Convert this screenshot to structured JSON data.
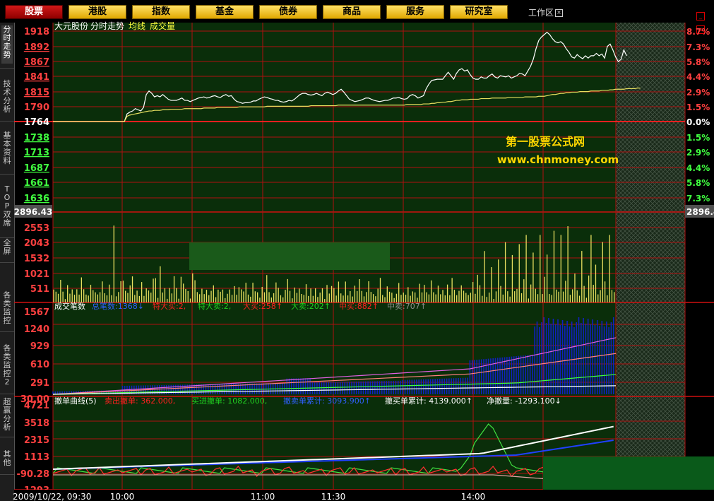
{
  "tabs": [
    {
      "label": "股票",
      "active": true
    },
    {
      "label": "港股"
    },
    {
      "label": "指数"
    },
    {
      "label": "基金"
    },
    {
      "label": "债券"
    },
    {
      "label": "商品"
    },
    {
      "label": "服务"
    },
    {
      "label": "研究室"
    }
  ],
  "workarea": {
    "label": "工作区",
    "close": "×"
  },
  "window_controls": [
    "_",
    "▫"
  ],
  "sidebar": [
    {
      "label": "分时走势",
      "active": true
    },
    {
      "label": "技术分析"
    },
    {
      "label": "基本资料"
    },
    {
      "label": "TOP双席"
    },
    {
      "label": "全屏"
    },
    {
      "label": "各类监控"
    },
    {
      "label": "各类监控2"
    },
    {
      "label": "超赢分析"
    },
    {
      "label": "其他"
    }
  ],
  "header": {
    "name": "大元股份",
    "view": "分时走势",
    "avg": "均线",
    "vol": "成交量"
  },
  "price_axis": {
    "left": [
      "1918",
      "1892",
      "1867",
      "1841",
      "1815",
      "1790",
      "1764",
      "1738",
      "1713",
      "1687",
      "1661",
      "1636"
    ],
    "right_up": [
      "8.7%",
      "7.3%",
      "5.8%",
      "4.4%",
      "2.9%",
      "1.5%"
    ],
    "right_zero": "0.0%",
    "right_down": [
      "1.5%",
      "2.9%",
      "4.4%",
      "5.8%",
      "7.3%"
    ],
    "box_left": "2896.43",
    "box_right": "2896.4"
  },
  "volume_axis": [
    "2553",
    "2043",
    "1532",
    "1021",
    "511"
  ],
  "watermark": {
    "line1": "第一股票公式网",
    "line2": "www.chnmoney.com"
  },
  "trade_panel": {
    "title": "成交笔数",
    "items": [
      {
        "label": "总笔数:",
        "value": "1368",
        "arrow": "↓",
        "color": "#3060ff"
      },
      {
        "label": "特大买:",
        "value": "2,",
        "arrow": "",
        "color": "#ff2020"
      },
      {
        "label": "特大卖:",
        "value": "2,",
        "arrow": "",
        "color": "#20d020"
      },
      {
        "label": "大买:",
        "value": "258",
        "arrow": "↑",
        "color": "#ff2020"
      },
      {
        "label": "大卖:",
        "value": "202",
        "arrow": "↑",
        "color": "#20d020"
      },
      {
        "label": "中买:",
        "value": "882",
        "arrow": "↑",
        "color": "#ff2020"
      },
      {
        "label": "中卖:",
        "value": "707",
        "arrow": "↑",
        "color": "#909090"
      }
    ],
    "axis": [
      "1567",
      "1240",
      "929",
      "610",
      "291",
      "30.00"
    ]
  },
  "cancel_panel": {
    "title": "撤单曲线(5)",
    "items": [
      {
        "label": "卖出撤单:",
        "value": "362.000,",
        "color": "#ff2020"
      },
      {
        "label": "买进撤单:",
        "value": "1082.000,",
        "color": "#20d020"
      },
      {
        "label": "撤卖单累计:",
        "value": "3093.900",
        "arrow": "↑",
        "color": "#3060ff"
      },
      {
        "label": "撤买单累计:",
        "value": "4139.000",
        "arrow": "↑",
        "color": "#ffffff"
      },
      {
        "label": "净撤量:",
        "value": "-1293.100",
        "arrow": "↓",
        "color": "#ffffff"
      }
    ],
    "axis": [
      "4721",
      "3518",
      "2315",
      "1113",
      "-90.28",
      "-1293"
    ]
  },
  "time_axis": {
    "start": "2009/10/22, 09:30",
    "labels": [
      "10:00",
      "11:00",
      "11:30",
      "14:00"
    ]
  },
  "chart_data": {
    "type": "line",
    "price_series": [
      1764,
      1764,
      1764,
      1764,
      1764,
      1764,
      1764,
      1764,
      1764,
      1764,
      1764,
      1764,
      1764,
      1764,
      1764,
      1764,
      1764,
      1764,
      1764,
      1764,
      1764,
      1764,
      1764,
      1764,
      1764,
      1764,
      1764,
      1777,
      1780,
      1782,
      1786,
      1784,
      1782,
      1788,
      1810,
      1816,
      1812,
      1806,
      1808,
      1806,
      1810,
      1806,
      1802,
      1800,
      1800,
      1800,
      1802,
      1804,
      1800,
      1800,
      1798,
      1800,
      1802,
      1804,
      1805,
      1806,
      1804,
      1805,
      1807,
      1808,
      1806,
      1805,
      1808,
      1810,
      1807,
      1808,
      1802,
      1798,
      1797,
      1795,
      1796,
      1796,
      1797,
      1799,
      1799,
      1802,
      1804,
      1806,
      1805,
      1803,
      1802,
      1800,
      1800,
      1798,
      1797,
      1798,
      1800,
      1799,
      1802,
      1806,
      1810,
      1812,
      1812,
      1810,
      1809,
      1810,
      1812,
      1810,
      1808,
      1812,
      1814,
      1812,
      1810,
      1812,
      1816,
      1819,
      1814,
      1808,
      1802,
      1800,
      1798,
      1799,
      1800,
      1802,
      1804,
      1804,
      1802,
      1800,
      1799,
      1798,
      1799,
      1800,
      1800,
      1802,
      1804,
      1804,
      1805,
      1803,
      1802,
      1803,
      1808,
      1810,
      1808,
      1804,
      1806,
      1808,
      1820,
      1828,
      1834,
      1835,
      1836,
      1836,
      1836,
      1842,
      1848,
      1842,
      1836,
      1846,
      1852,
      1854,
      1850,
      1852,
      1844,
      1838,
      1836,
      1836,
      1840,
      1838,
      1838,
      1842,
      1845,
      1840,
      1838,
      1842,
      1841,
      1840,
      1842,
      1838,
      1840,
      1842,
      1846,
      1845,
      1842,
      1850,
      1858,
      1870,
      1888,
      1902,
      1908,
      1912,
      1916,
      1912,
      1905,
      1900,
      1898,
      1900,
      1896,
      1888,
      1882,
      1874,
      1872,
      1878,
      1874,
      1871,
      1876,
      1872,
      1876,
      1876,
      1880,
      1876,
      1879,
      1872,
      1892,
      1896,
      1886,
      1874,
      1866,
      1870,
      1886,
      1876
    ],
    "avg_series": [
      1764,
      1764,
      1764,
      1764,
      1764,
      1764,
      1764,
      1764,
      1764,
      1764,
      1764,
      1764,
      1764,
      1764,
      1764,
      1764,
      1764,
      1764,
      1764,
      1764,
      1764,
      1764,
      1764,
      1764,
      1764,
      1764,
      1764,
      1773,
      1775,
      1776,
      1777,
      1778,
      1779,
      1780,
      1781,
      1782,
      1782,
      1783,
      1783,
      1783,
      1784,
      1784,
      1784,
      1785,
      1785,
      1785,
      1785,
      1785,
      1786,
      1786,
      1786,
      1786,
      1786,
      1786,
      1786,
      1787,
      1787,
      1787,
      1787,
      1787,
      1788,
      1788,
      1788,
      1788,
      1788,
      1788,
      1788,
      1788,
      1789,
      1789,
      1789,
      1789,
      1789,
      1789,
      1789,
      1789,
      1789,
      1789,
      1790,
      1790,
      1790,
      1790,
      1790,
      1790,
      1790,
      1790,
      1790,
      1790,
      1790,
      1790,
      1790,
      1790,
      1790,
      1790,
      1791,
      1791,
      1791,
      1791,
      1791,
      1791,
      1791,
      1791,
      1791,
      1791,
      1792,
      1792,
      1792,
      1792,
      1792,
      1792,
      1792,
      1792,
      1792,
      1792,
      1792,
      1792,
      1792,
      1792,
      1792,
      1792,
      1792,
      1792,
      1792,
      1792,
      1792,
      1792,
      1792,
      1792,
      1792,
      1793,
      1793,
      1793,
      1793,
      1793,
      1793,
      1794,
      1794,
      1794,
      1795,
      1795,
      1796,
      1796,
      1797,
      1797,
      1798,
      1798,
      1799,
      1800,
      1800,
      1801,
      1801,
      1801,
      1802,
      1802,
      1802,
      1802,
      1803,
      1803,
      1803,
      1803,
      1804,
      1804,
      1804,
      1804,
      1804,
      1804,
      1805,
      1805,
      1805,
      1805,
      1805,
      1805,
      1806,
      1806,
      1806,
      1806,
      1806,
      1807,
      1807,
      1807,
      1808,
      1809,
      1810,
      1810,
      1811,
      1812,
      1812,
      1813,
      1813,
      1814,
      1814,
      1814,
      1815,
      1815,
      1815,
      1815,
      1816,
      1816,
      1816,
      1816,
      1817,
      1817,
      1817,
      1818,
      1818,
      1819,
      1819,
      1819,
      1819,
      1820,
      1820,
      1820,
      1820,
      1821,
      1821
    ]
  }
}
